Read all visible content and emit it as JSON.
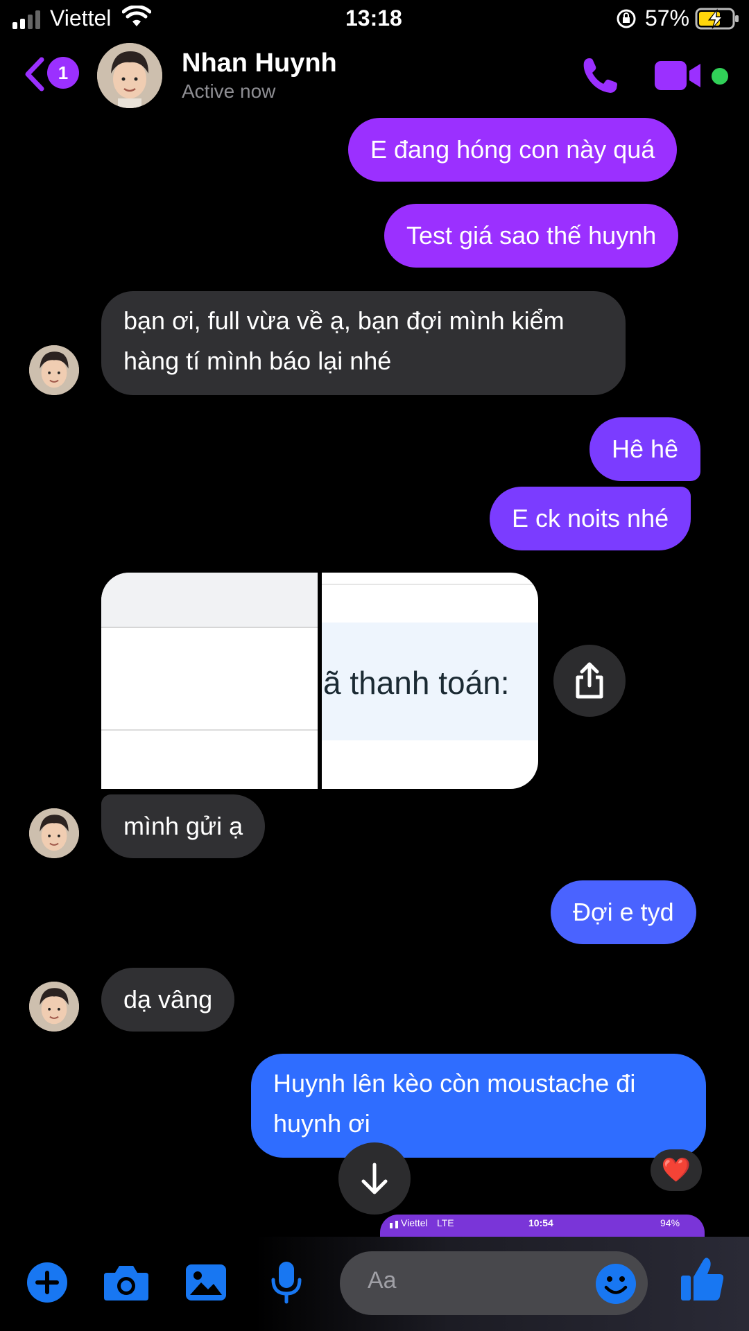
{
  "status_bar": {
    "carrier": "Viettel",
    "time": "13:18",
    "battery_percent": "57%",
    "signal_icon": "signal-bars-icon",
    "wifi_icon": "wifi-icon",
    "lock_icon": "orientation-lock-icon",
    "battery_icon": "battery-charging-icon"
  },
  "header": {
    "back_icon": "chevron-left-icon",
    "unread_count": "1",
    "contact_name": "Nhan Huynh",
    "contact_status": "Active now",
    "call_icon": "phone-icon",
    "video_icon": "video-camera-icon",
    "online_color": "#31d158",
    "accent_color": "#9b30ff"
  },
  "messages": [
    {
      "from": "me",
      "text": "E đang hóng con này quá"
    },
    {
      "from": "me",
      "text": "Test giá sao thế huynh"
    },
    {
      "from": "them",
      "text": "bạn ơi, full vừa về ạ, bạn đợi mình kiểm hàng tí mình báo lại nhé"
    },
    {
      "from": "me",
      "text": "Hê hê"
    },
    {
      "from": "me",
      "text": "E ck noits nhé"
    },
    {
      "from": "them",
      "type": "images",
      "image_text": "ã thanh toán:",
      "share_icon": "share-icon"
    },
    {
      "from": "them",
      "text": "mình gửi ạ"
    },
    {
      "from": "me",
      "text": "Đợi e tyd"
    },
    {
      "from": "them",
      "text": "dạ vâng"
    },
    {
      "from": "me",
      "text": "Huynh lên kèo còn moustache đi huynh ơi",
      "reaction": "❤️"
    }
  ],
  "preview_screenshot": {
    "carrier": "Viettel",
    "network": "LTE",
    "time": "10:54",
    "battery": "94%"
  },
  "scroll_down_icon": "arrow-down-icon",
  "composer": {
    "placeholder": "Aa",
    "plus_icon": "plus-circle-icon",
    "camera_icon": "camera-icon",
    "gallery_icon": "image-icon",
    "mic_icon": "microphone-icon",
    "emoji_icon": "emoji-icon",
    "like_icon": "thumbs-up-icon"
  }
}
